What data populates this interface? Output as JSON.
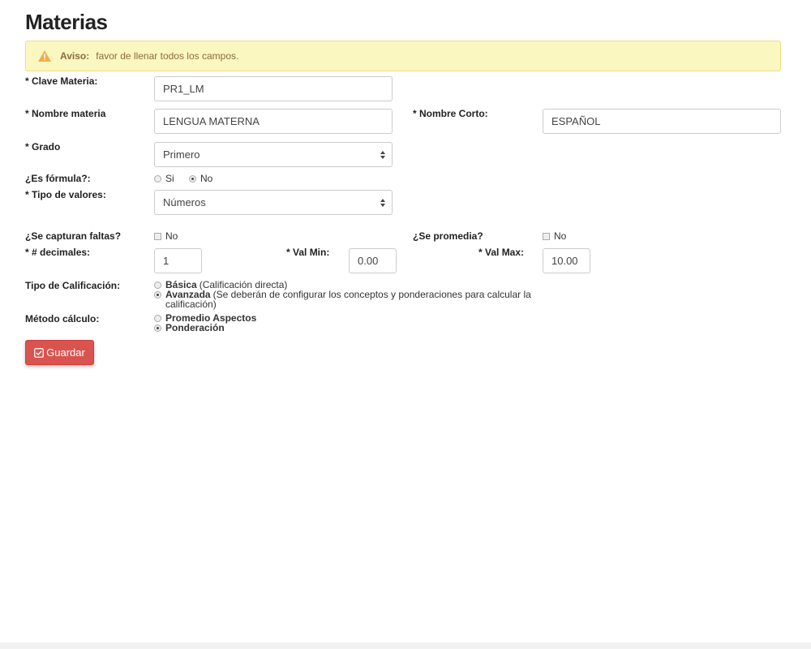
{
  "page": {
    "title": "Materias"
  },
  "alert": {
    "title": "Aviso:",
    "message": "favor de llenar todos los campos."
  },
  "form": {
    "clave_materia": {
      "label": "* Clave Materia:",
      "value": "PR1_LM"
    },
    "nombre_materia": {
      "label": "* Nombre materia",
      "value": "LENGUA MATERNA"
    },
    "nombre_corto": {
      "label": "* Nombre Corto:",
      "value": "ESPAÑOL"
    },
    "grado": {
      "label": "* Grado",
      "selected": "Primero"
    },
    "es_formula": {
      "label": "¿Es fórmula?:",
      "options": [
        {
          "label": "Si",
          "checked": false
        },
        {
          "label": "No",
          "checked": true
        }
      ]
    },
    "tipo_valores": {
      "label": "* Tipo de valores:",
      "selected": "Números"
    },
    "captura_faltas": {
      "label": "¿Se capturan faltas?",
      "check_label": "No",
      "checked": false
    },
    "se_promedia": {
      "label": "¿Se promedia?",
      "check_label": "No",
      "checked": false
    },
    "decimales": {
      "label": "* # decimales:",
      "value": "1"
    },
    "val_min": {
      "label": "* Val Min:",
      "value": "0.00"
    },
    "val_max": {
      "label": "* Val Max:",
      "value": "10.00"
    },
    "tipo_calificacion": {
      "label": "Tipo de Calificación:",
      "options": [
        {
          "title": "Básica",
          "desc": "(Calificación directa)",
          "checked": false
        },
        {
          "title": "Avanzada",
          "desc": "(Se deberán de configurar los conceptos y ponderaciones para calcular la calificación)",
          "checked": true
        }
      ]
    },
    "metodo_calculo": {
      "label": "Método cálculo:",
      "options": [
        {
          "title": "Promedio Aspectos",
          "checked": false
        },
        {
          "title": "Ponderación",
          "checked": true
        }
      ]
    }
  },
  "actions": {
    "save_label": "Guardar"
  },
  "colors": {
    "danger": "#d9534f",
    "warning_bg": "#fbf7c0",
    "warning_text": "#8a6d3b"
  },
  "icons": {
    "alert": "warning-triangle-icon",
    "save": "check-square-icon",
    "select": "sort-caret-icon"
  }
}
